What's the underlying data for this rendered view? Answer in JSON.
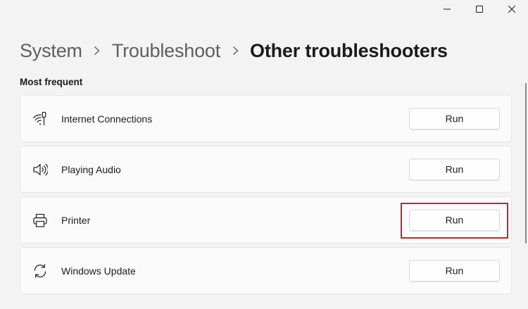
{
  "window": {
    "minimize_icon": "minimize-icon",
    "maximize_icon": "maximize-icon",
    "close_icon": "close-icon"
  },
  "breadcrumb": {
    "items": [
      "System",
      "Troubleshoot",
      "Other troubleshooters"
    ],
    "separator_icon": "chevron-right-icon"
  },
  "section": {
    "title": "Most frequent"
  },
  "troubleshooters": [
    {
      "label": "Internet Connections",
      "icon": "wifi-signal-icon",
      "button": "Run"
    },
    {
      "label": "Playing Audio",
      "icon": "speaker-icon",
      "button": "Run"
    },
    {
      "label": "Printer",
      "icon": "printer-icon",
      "button": "Run"
    },
    {
      "label": "Windows Update",
      "icon": "sync-arrows-icon",
      "button": "Run"
    }
  ],
  "colors": {
    "background": "#f3f3f3",
    "card": "#fbfbfb",
    "highlight": "#c8232c"
  }
}
